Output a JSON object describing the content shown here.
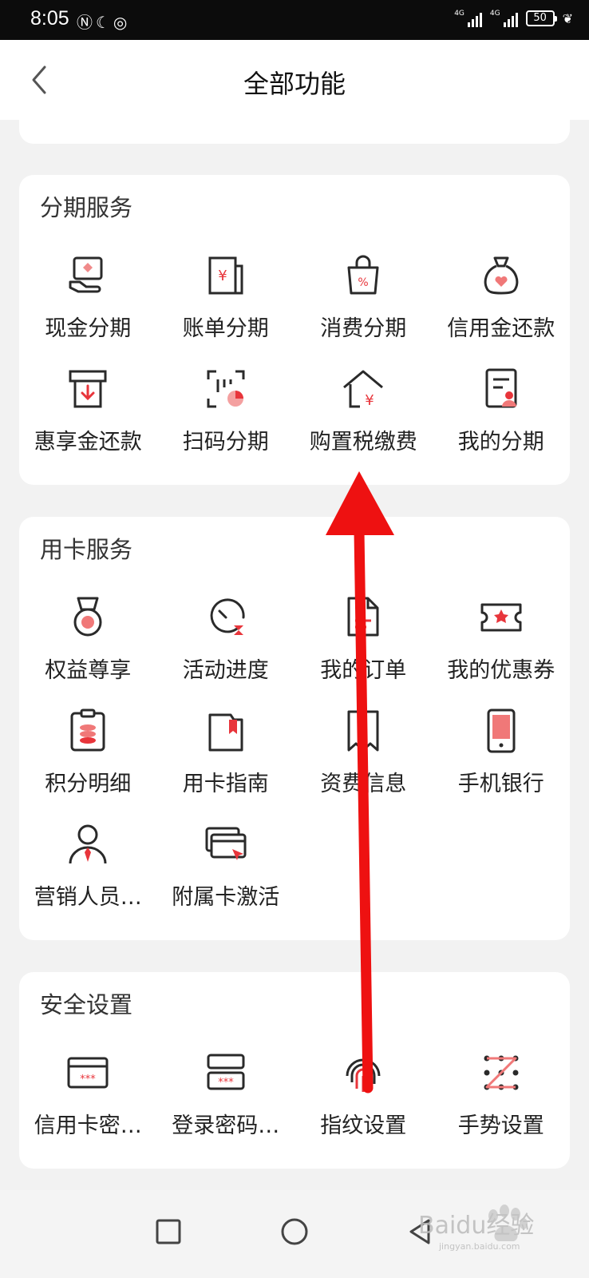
{
  "status_bar": {
    "time": "8:05",
    "net1": "4G",
    "net2": "4G",
    "battery": "50"
  },
  "header": {
    "title": "全部功能"
  },
  "sections": [
    {
      "title": "分期服务",
      "items": [
        {
          "label": "现金分期",
          "icon": "cash-installment-icon"
        },
        {
          "label": "账单分期",
          "icon": "bill-installment-icon"
        },
        {
          "label": "消费分期",
          "icon": "shopping-bag-icon"
        },
        {
          "label": "信用金还款",
          "icon": "money-bag-icon"
        },
        {
          "label": "惠享金还款",
          "icon": "repay-icon"
        },
        {
          "label": "扫码分期",
          "icon": "scan-installment-icon"
        },
        {
          "label": "购置税缴费",
          "icon": "house-yen-icon"
        },
        {
          "label": "我的分期",
          "icon": "my-installment-icon"
        }
      ]
    },
    {
      "title": "用卡服务",
      "items": [
        {
          "label": "权益尊享",
          "icon": "medal-icon"
        },
        {
          "label": "活动进度",
          "icon": "progress-timer-icon"
        },
        {
          "label": "我的订单",
          "icon": "order-doc-icon"
        },
        {
          "label": "我的优惠券",
          "icon": "coupon-icon"
        },
        {
          "label": "积分明细",
          "icon": "points-clipboard-icon"
        },
        {
          "label": "用卡指南",
          "icon": "guide-book-icon"
        },
        {
          "label": "资费信息",
          "icon": "fee-receipt-icon"
        },
        {
          "label": "手机银行",
          "icon": "mobile-phone-icon"
        },
        {
          "label": "营销人员…",
          "icon": "salesperson-icon"
        },
        {
          "label": "附属卡激活",
          "icon": "card-activate-icon"
        }
      ]
    },
    {
      "title": "安全设置",
      "items": [
        {
          "label": "信用卡密…",
          "icon": "card-password-icon"
        },
        {
          "label": "登录密码…",
          "icon": "login-password-icon"
        },
        {
          "label": "指纹设置",
          "icon": "fingerprint-icon"
        },
        {
          "label": "手势设置",
          "icon": "gesture-icon"
        }
      ]
    }
  ],
  "watermark": {
    "text": "Baidu经验",
    "sub": "jingyan.baidu.com"
  },
  "colors": {
    "accent": "#e8353b",
    "icon_dark": "#2a2a2a",
    "annotation_arrow": "#ee1111"
  }
}
